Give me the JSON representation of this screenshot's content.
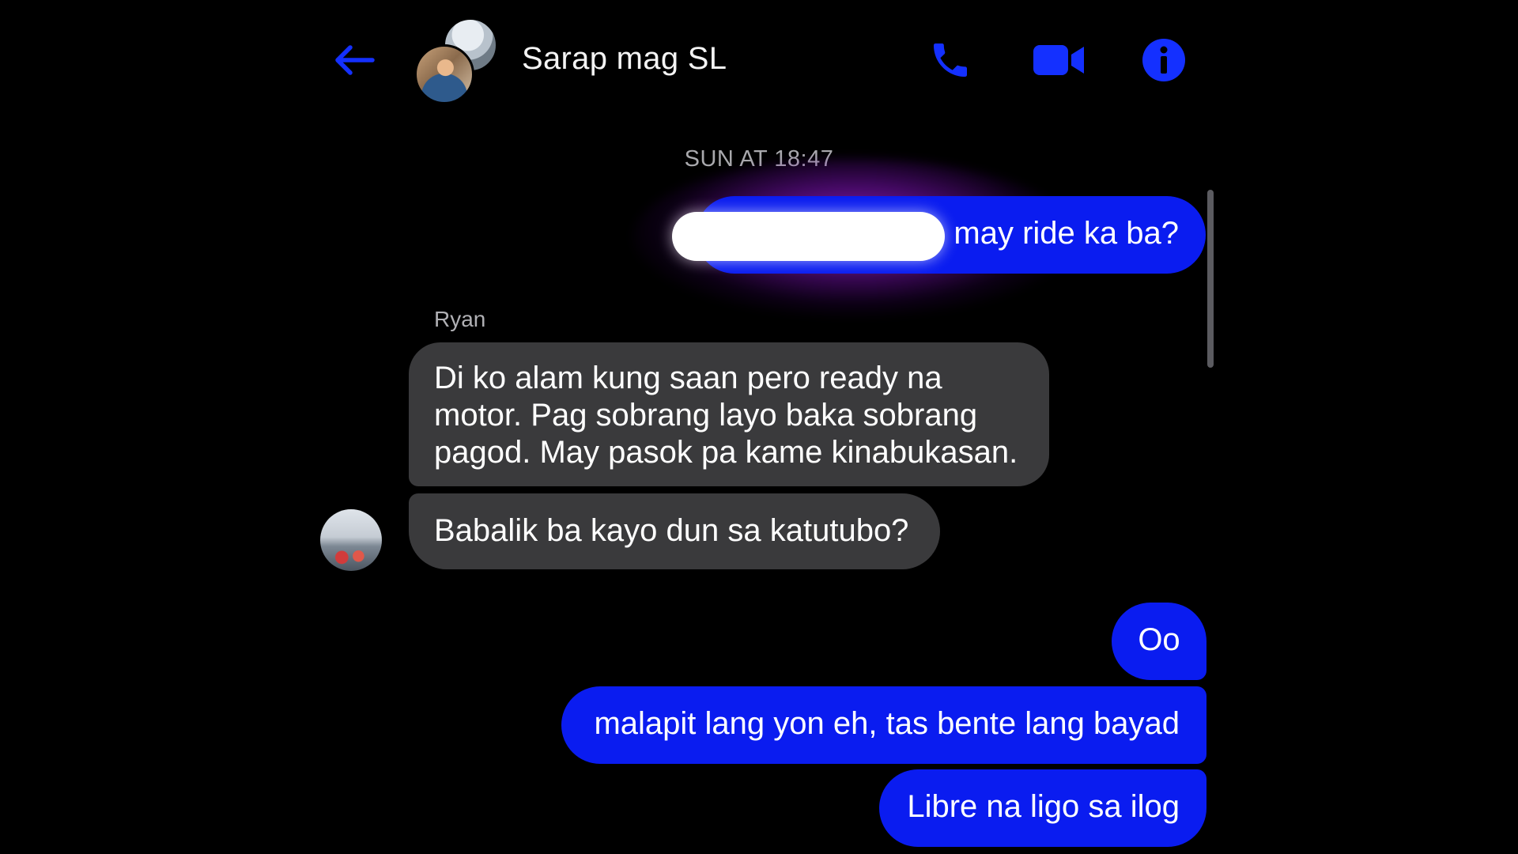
{
  "header": {
    "title": "Sarap mag SL",
    "back_icon": "arrow-left-icon",
    "call_icon": "phone-icon",
    "video_icon": "video-camera-icon",
    "info_icon": "info-icon",
    "accent_color": "#0a1cf0"
  },
  "timestamp": "SUN AT 18:47",
  "messages": [
    {
      "direction": "outgoing",
      "text": "may ride ka ba?",
      "redacted_prefix": true
    },
    {
      "direction": "incoming",
      "sender": "Ryan",
      "lines": [
        "Di ko alam kung saan pero ready na",
        "motor. Pag sobrang layo baka sobrang",
        "pagod. May pasok pa kame kinabukasan."
      ]
    },
    {
      "direction": "incoming",
      "text": "Babalik ba kayo dun sa katutubo?"
    },
    {
      "direction": "outgoing",
      "text": "Oo"
    },
    {
      "direction": "outgoing",
      "text": "malapit lang yon eh, tas bente lang bayad"
    },
    {
      "direction": "outgoing",
      "text": "Libre na ligo sa ilog"
    }
  ],
  "colors": {
    "outgoing_bubble": "#0a1cf0",
    "incoming_bubble": "#3a3a3c",
    "background": "#000000",
    "glow": "#c828ff"
  }
}
